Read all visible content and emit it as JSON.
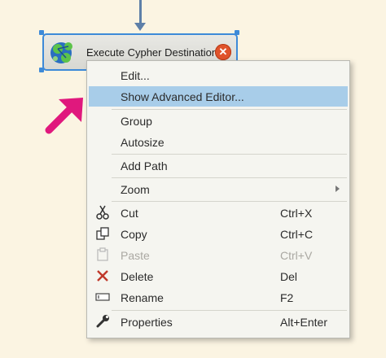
{
  "task": {
    "label": "Execute Cypher Destination",
    "error_glyph": "✕"
  },
  "menu": {
    "items": [
      {
        "label": "Edit..."
      },
      {
        "label": "Show Advanced Editor..."
      },
      {
        "label": "Group"
      },
      {
        "label": "Autosize"
      },
      {
        "label": "Add Path"
      },
      {
        "label": "Zoom"
      },
      {
        "label": "Cut",
        "shortcut": "Ctrl+X"
      },
      {
        "label": "Copy",
        "shortcut": "Ctrl+C"
      },
      {
        "label": "Paste",
        "shortcut": "Ctrl+V"
      },
      {
        "label": "Delete",
        "shortcut": "Del"
      },
      {
        "label": "Rename",
        "shortcut": "F2"
      },
      {
        "label": "Properties",
        "shortcut": "Alt+Enter"
      }
    ]
  },
  "colors": {
    "background": "#fbf4e2",
    "highlight": "#a8cde9",
    "selection_border": "#3d8ad8",
    "pointer_arrow": "#e0187d",
    "delete_icon": "#c0392b"
  }
}
